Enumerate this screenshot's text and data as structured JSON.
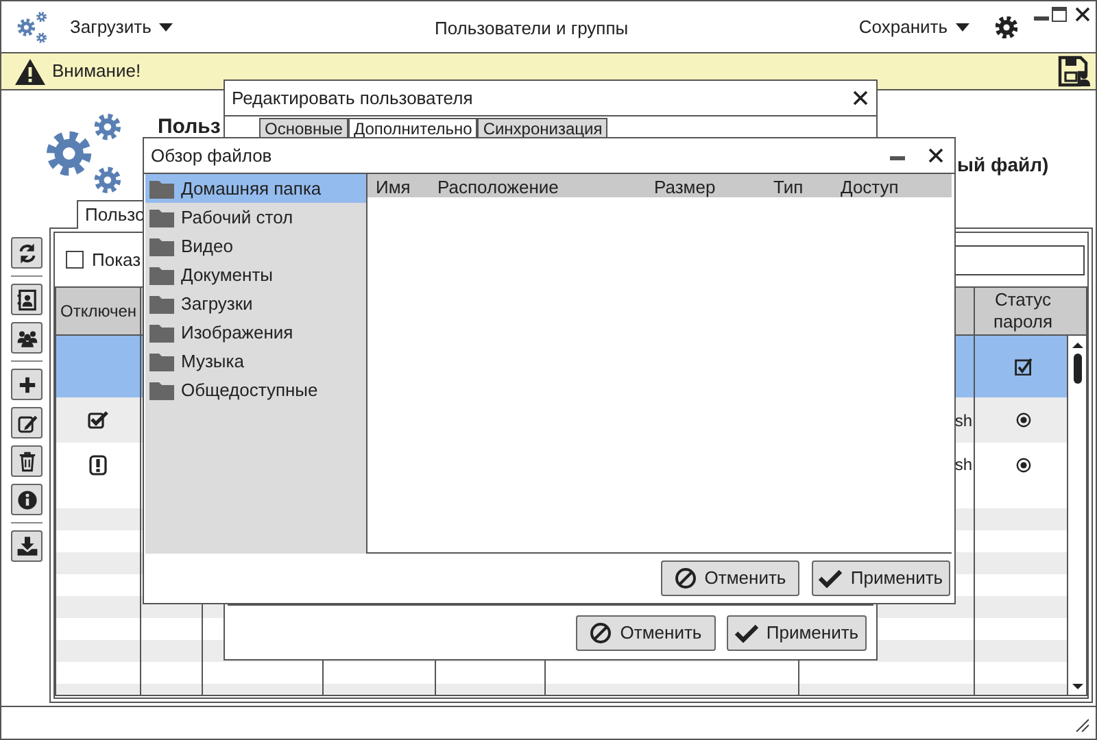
{
  "window": {
    "menu_button": "Загрузить",
    "title": "Пользователи и группы",
    "save_button": "Сохранить"
  },
  "alert": {
    "text": "Внимание!"
  },
  "header": {
    "title": "Польз",
    "subtitle": "ый файл)"
  },
  "tab": {
    "label": "Пользо",
    "selected": true
  },
  "show_checkbox": {
    "label": "Показ",
    "checked": false
  },
  "table": {
    "columns": [
      "Отключен",
      "Статус пароля"
    ],
    "rows": [
      {
        "selected": true,
        "password_status": {
          "kind": "checkbox"
        }
      },
      {
        "selected": false,
        "disabled_mark": {
          "kind": "check"
        },
        "column_7": "sh",
        "password_status": {
          "kind": "radio"
        }
      },
      {
        "selected": false,
        "disabled_mark": {
          "kind": "alert"
        },
        "column_7": "sh",
        "password_status": {
          "kind": "radio"
        }
      }
    ]
  },
  "edit_dialog": {
    "title": "Редактировать пользователя",
    "tabs": [
      {
        "label": "Основные",
        "selected": false
      },
      {
        "label": "Дополнительно",
        "selected": true
      },
      {
        "label": "Синхронизация",
        "selected": false
      }
    ],
    "buttons": [
      {
        "kind": "cancel",
        "label": "Отменить"
      },
      {
        "kind": "apply",
        "label": "Применить"
      }
    ]
  },
  "file_dialog": {
    "title": "Обзор файлов",
    "places": [
      {
        "label": "Домашняя папка",
        "selected": true
      },
      {
        "label": "Рабочий стол",
        "selected": false
      },
      {
        "label": "Видео",
        "selected": false
      },
      {
        "label": "Документы",
        "selected": false
      },
      {
        "label": "Загрузки",
        "selected": false
      },
      {
        "label": "Изображения",
        "selected": false
      },
      {
        "label": "Музыка",
        "selected": false
      },
      {
        "label": "Общедоступные",
        "selected": false
      }
    ],
    "columns": [
      "Имя",
      "Расположение",
      "Размер",
      "Тип",
      "Доступ"
    ],
    "buttons": [
      {
        "kind": "cancel",
        "label": "Отменить"
      },
      {
        "kind": "apply",
        "label": "Применить"
      }
    ]
  }
}
